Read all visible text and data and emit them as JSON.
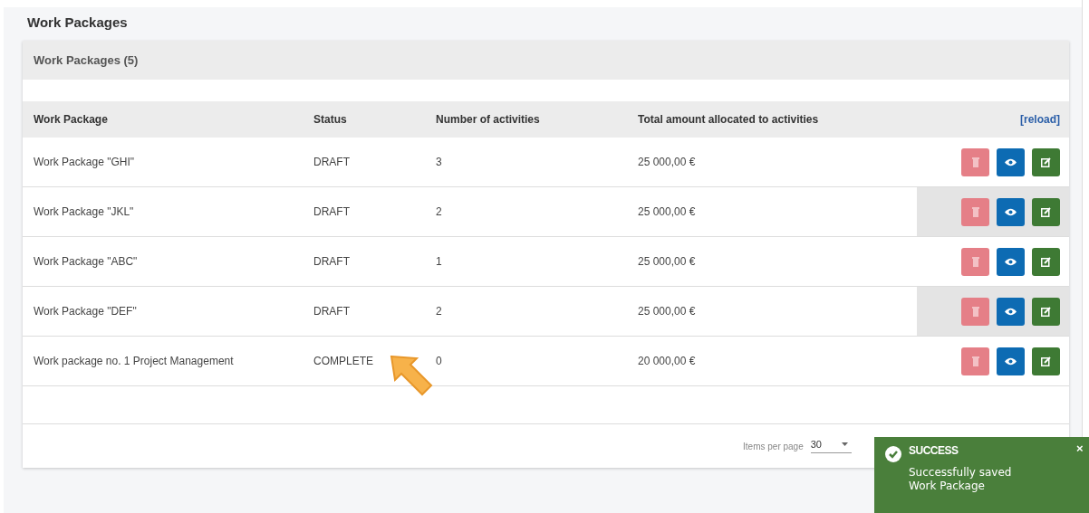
{
  "page_title": "Work Packages",
  "card_title": "Work Packages (5)",
  "table": {
    "columns": [
      "Work Package",
      "Status",
      "Number of activities",
      "Total amount allocated to activities"
    ],
    "reload": "[reload]",
    "rows": [
      {
        "name": "Work Package \"GHI\"",
        "status": "DRAFT",
        "activities": "3",
        "amount": "25 000,00 €",
        "highlighted": false
      },
      {
        "name": "Work Package \"JKL\"",
        "status": "DRAFT",
        "activities": "2",
        "amount": "25 000,00 €",
        "highlighted": true
      },
      {
        "name": "Work Package \"ABC\"",
        "status": "DRAFT",
        "activities": "1",
        "amount": "25 000,00 €",
        "highlighted": false
      },
      {
        "name": "Work Package \"DEF\"",
        "status": "DRAFT",
        "activities": "2",
        "amount": "25 000,00 €",
        "highlighted": true
      },
      {
        "name": "Work package no. 1 Project Management",
        "status": "COMPLETE",
        "activities": "0",
        "amount": "20 000,00 €",
        "highlighted": false
      }
    ]
  },
  "pagination": {
    "label": "Items per page",
    "value": "30"
  },
  "toast": {
    "title": "SUCCESS",
    "message": "Successfully saved\nWork Package",
    "close": "×"
  }
}
